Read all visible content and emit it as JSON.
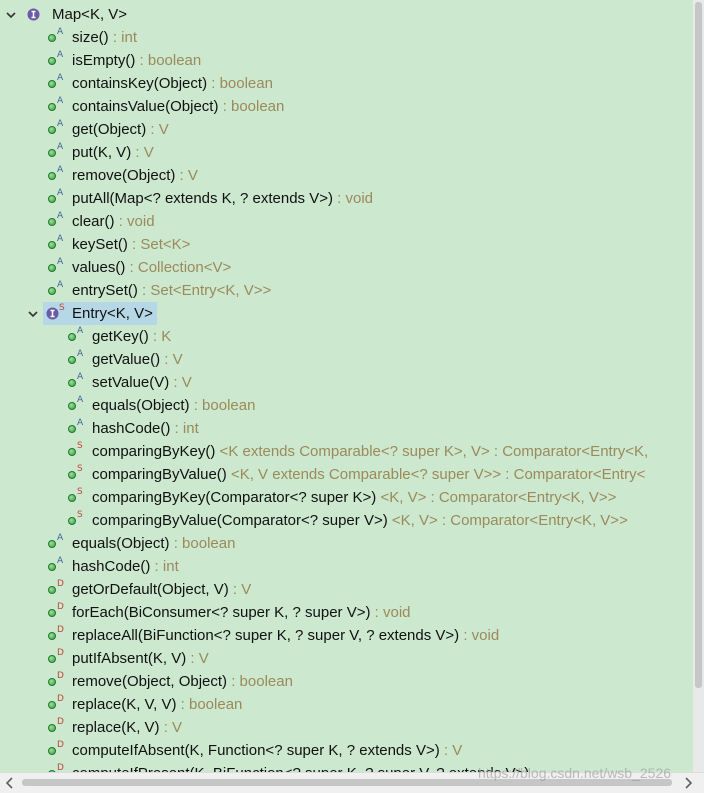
{
  "colors": {
    "background": "#cce8cf",
    "text": "#111111",
    "detail_text": "#9b8a5a",
    "selection": "#b6d8e6",
    "public_method_fill": "#3d9b44",
    "interface_icon": "#6a5aa8",
    "abstract_marker": "#41629b",
    "static_marker": "#c1473e",
    "default_marker": "#b8483a"
  },
  "tree": {
    "rows": [
      {
        "level": 0,
        "kind": "interface",
        "expanded": true,
        "name": "Map<K, V>",
        "detail": ""
      },
      {
        "level": 1,
        "kind": "method",
        "marker": "A",
        "name": "size()",
        "detail": " : int"
      },
      {
        "level": 1,
        "kind": "method",
        "marker": "A",
        "name": "isEmpty()",
        "detail": " : boolean"
      },
      {
        "level": 1,
        "kind": "method",
        "marker": "A",
        "name": "containsKey(Object)",
        "detail": " : boolean"
      },
      {
        "level": 1,
        "kind": "method",
        "marker": "A",
        "name": "containsValue(Object)",
        "detail": " : boolean"
      },
      {
        "level": 1,
        "kind": "method",
        "marker": "A",
        "name": "get(Object)",
        "detail": " : V"
      },
      {
        "level": 1,
        "kind": "method",
        "marker": "A",
        "name": "put(K, V)",
        "detail": " : V"
      },
      {
        "level": 1,
        "kind": "method",
        "marker": "A",
        "name": "remove(Object)",
        "detail": " : V"
      },
      {
        "level": 1,
        "kind": "method",
        "marker": "A",
        "name": "putAll(Map<? extends K, ? extends V>)",
        "detail": " : void"
      },
      {
        "level": 1,
        "kind": "method",
        "marker": "A",
        "name": "clear()",
        "detail": " : void"
      },
      {
        "level": 1,
        "kind": "method",
        "marker": "A",
        "name": "keySet()",
        "detail": " : Set<K>"
      },
      {
        "level": 1,
        "kind": "method",
        "marker": "A",
        "name": "values()",
        "detail": " : Collection<V>"
      },
      {
        "level": 1,
        "kind": "method",
        "marker": "A",
        "name": "entrySet()",
        "detail": " : Set<Entry<K, V>>"
      },
      {
        "level": 1,
        "kind": "interface",
        "marker": "S",
        "expanded": true,
        "selected": true,
        "name": "Entry<K, V>",
        "detail": ""
      },
      {
        "level": 2,
        "kind": "method",
        "marker": "A",
        "name": "getKey()",
        "detail": " : K"
      },
      {
        "level": 2,
        "kind": "method",
        "marker": "A",
        "name": "getValue()",
        "detail": " : V"
      },
      {
        "level": 2,
        "kind": "method",
        "marker": "A",
        "name": "setValue(V)",
        "detail": " : V"
      },
      {
        "level": 2,
        "kind": "method",
        "marker": "A",
        "name": "equals(Object)",
        "detail": " : boolean"
      },
      {
        "level": 2,
        "kind": "method",
        "marker": "A",
        "name": "hashCode()",
        "detail": " : int"
      },
      {
        "level": 2,
        "kind": "method",
        "marker": "S",
        "name": "comparingByKey()",
        "detail": " <K extends Comparable<? super K>, V> : Comparator<Entry<K,"
      },
      {
        "level": 2,
        "kind": "method",
        "marker": "S",
        "name": "comparingByValue()",
        "detail": " <K, V extends Comparable<? super V>> : Comparator<Entry<"
      },
      {
        "level": 2,
        "kind": "method",
        "marker": "S",
        "name": "comparingByKey(Comparator<? super K>)",
        "detail": " <K, V> : Comparator<Entry<K, V>>"
      },
      {
        "level": 2,
        "kind": "method",
        "marker": "S",
        "name": "comparingByValue(Comparator<? super V>)",
        "detail": " <K, V> : Comparator<Entry<K, V>>"
      },
      {
        "level": 1,
        "kind": "method",
        "marker": "A",
        "name": "equals(Object)",
        "detail": " : boolean"
      },
      {
        "level": 1,
        "kind": "method",
        "marker": "A",
        "name": "hashCode()",
        "detail": " : int"
      },
      {
        "level": 1,
        "kind": "method",
        "marker": "D",
        "name": "getOrDefault(Object, V)",
        "detail": " : V"
      },
      {
        "level": 1,
        "kind": "method",
        "marker": "D",
        "name": "forEach(BiConsumer<? super K, ? super V>)",
        "detail": " : void"
      },
      {
        "level": 1,
        "kind": "method",
        "marker": "D",
        "name": "replaceAll(BiFunction<? super K, ? super V, ? extends V>)",
        "detail": " : void"
      },
      {
        "level": 1,
        "kind": "method",
        "marker": "D",
        "name": "putIfAbsent(K, V)",
        "detail": " : V"
      },
      {
        "level": 1,
        "kind": "method",
        "marker": "D",
        "name": "remove(Object, Object)",
        "detail": " : boolean"
      },
      {
        "level": 1,
        "kind": "method",
        "marker": "D",
        "name": "replace(K, V, V)",
        "detail": " : boolean"
      },
      {
        "level": 1,
        "kind": "method",
        "marker": "D",
        "name": "replace(K, V)",
        "detail": " : V"
      },
      {
        "level": 1,
        "kind": "method",
        "marker": "D",
        "name": "computeIfAbsent(K, Function<? super K, ? extends V>)",
        "detail": " : V"
      },
      {
        "level": 1,
        "kind": "method",
        "marker": "D",
        "name": "computeIfPresent(K, BiFunction<? super K, ? super V, ? extends V>)",
        "detail": ""
      }
    ]
  },
  "icons": {
    "tree_toggle": "chevron-down-icon",
    "interface": "interface-icon",
    "public_method": "public-method-icon",
    "scroll_left": "scroll-left-arrow-icon",
    "scroll_right": "scroll-right-arrow-icon"
  },
  "watermark": "https://blog.csdn.net/wsb_2526"
}
